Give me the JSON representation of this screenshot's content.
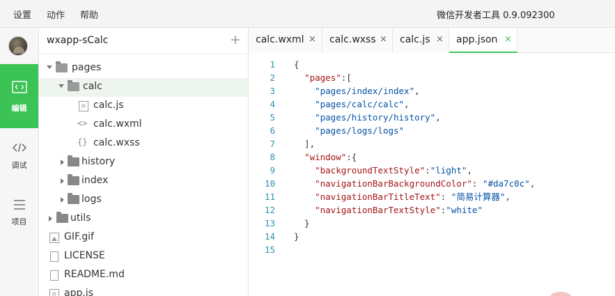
{
  "menu": {
    "items": [
      "设置",
      "动作",
      "帮助"
    ],
    "app_title": "微信开发者工具 0.9.092300"
  },
  "rail": {
    "avatar": "avatar",
    "buttons": [
      {
        "label": "编辑",
        "icon": "code-edit-icon",
        "active": true
      },
      {
        "label": "调试",
        "icon": "debug-code-icon",
        "active": false
      },
      {
        "label": "项目",
        "icon": "menu-lines-icon",
        "active": false
      }
    ]
  },
  "filepanel": {
    "title": "wxapp-sCalc",
    "add_label": "+",
    "tree": [
      {
        "label": "pages",
        "type": "folder",
        "expanded": true,
        "depth": 0
      },
      {
        "label": "calc",
        "type": "folder",
        "expanded": true,
        "depth": 1,
        "selected": true
      },
      {
        "label": "calc.js",
        "type": "js",
        "depth": 2
      },
      {
        "label": "calc.wxml",
        "type": "wxml",
        "depth": 2
      },
      {
        "label": "calc.wxss",
        "type": "wxss",
        "depth": 2
      },
      {
        "label": "history",
        "type": "folder",
        "expanded": false,
        "depth": 1
      },
      {
        "label": "index",
        "type": "folder",
        "expanded": false,
        "depth": 1
      },
      {
        "label": "logs",
        "type": "folder",
        "expanded": false,
        "depth": 1
      },
      {
        "label": "utils",
        "type": "folder",
        "expanded": false,
        "depth": 0
      },
      {
        "label": "GIF.gif",
        "type": "image",
        "depth": 0
      },
      {
        "label": "LICENSE",
        "type": "doc",
        "depth": 0
      },
      {
        "label": "README.md",
        "type": "doc",
        "depth": 0
      },
      {
        "label": "app.js",
        "type": "js",
        "depth": 0
      }
    ]
  },
  "editor": {
    "tabs": [
      {
        "label": "calc.wxml",
        "close": "×",
        "active": false
      },
      {
        "label": "calc.wxss",
        "close": "×",
        "active": false
      },
      {
        "label": "calc.js",
        "close": "×",
        "active": false
      },
      {
        "label": "app.json",
        "close": "×",
        "active": true
      }
    ],
    "lines": [
      {
        "n": "1",
        "t": "{"
      },
      {
        "n": "2",
        "t": "  \"pages\":["
      },
      {
        "n": "3",
        "t": "    \"pages/index/index\","
      },
      {
        "n": "4",
        "t": "    \"pages/calc/calc\","
      },
      {
        "n": "5",
        "t": "    \"pages/history/history\","
      },
      {
        "n": "6",
        "t": "    \"pages/logs/logs\""
      },
      {
        "n": "7",
        "t": "  ],"
      },
      {
        "n": "8",
        "t": "  \"window\":{"
      },
      {
        "n": "9",
        "t": "    \"backgroundTextStyle\":\"light\","
      },
      {
        "n": "10",
        "t": "    \"navigationBarBackgroundColor\": \"#da7c0c\","
      },
      {
        "n": "11",
        "t": "    \"navigationBarTitleText\": \"简易计算器\","
      },
      {
        "n": "12",
        "t": "    \"navigationBarTextStyle\":\"white\""
      },
      {
        "n": "13",
        "t": "  }"
      },
      {
        "n": "14",
        "t": "}"
      },
      {
        "n": "15",
        "t": ""
      }
    ]
  },
  "colors": {
    "accent": "#3cc355",
    "line_number": "#2b91af",
    "string_key": "#a31515",
    "string_value": "#0451a5"
  }
}
